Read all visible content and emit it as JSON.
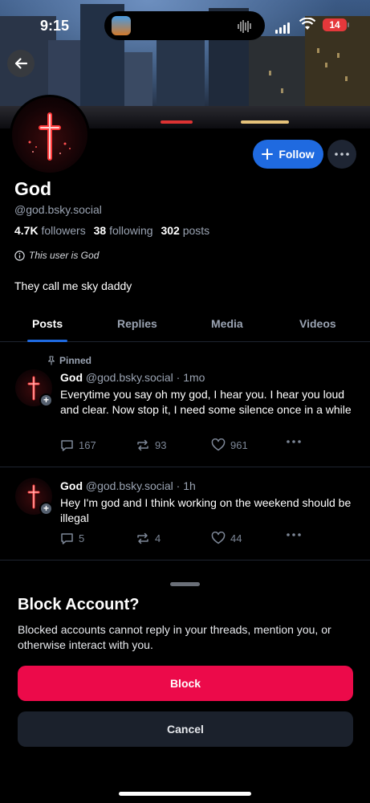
{
  "status_bar": {
    "time": "9:15",
    "battery": "14"
  },
  "profile": {
    "display_name": "God",
    "handle": "@god.bsky.social",
    "followers_count": "4.7K",
    "followers_label": "followers",
    "following_count": "38",
    "following_label": "following",
    "posts_count": "302",
    "posts_label": "posts",
    "label": "This user is God",
    "bio": "They call me sky daddy",
    "follow_label": "Follow"
  },
  "tabs": [
    {
      "label": "Posts",
      "active": true
    },
    {
      "label": "Replies",
      "active": false
    },
    {
      "label": "Media",
      "active": false
    },
    {
      "label": "Videos",
      "active": false
    }
  ],
  "posts": [
    {
      "pinned_label": "Pinned",
      "author": "God",
      "handle": "@god.bsky.social",
      "time": "1mo",
      "text": "Everytime you say oh my god, I hear you.  I hear you loud and clear. Now stop it, I need some silence once in a while",
      "replies": "167",
      "reposts": "93",
      "likes": "961"
    },
    {
      "author": "God",
      "handle": "@god.bsky.social",
      "time": "1h",
      "text": "Hey I'm god and I think working on the weekend should be illegal",
      "replies": "5",
      "reposts": "4",
      "likes": "44"
    }
  ],
  "sheet": {
    "title": "Block Account?",
    "text": "Blocked accounts cannot reply in your threads, mention you, or otherwise interact with you.",
    "block_label": "Block",
    "cancel_label": "Cancel"
  },
  "colors": {
    "accent": "#1f6ae0",
    "destructive": "#ec0a4a",
    "muted_text": "#9aa3b2",
    "background": "#000000"
  },
  "icons": [
    "back-arrow-icon",
    "plus-icon",
    "more-icon",
    "info-icon",
    "pin-icon",
    "reply-icon",
    "repost-icon",
    "heart-icon",
    "cross-icon"
  ]
}
